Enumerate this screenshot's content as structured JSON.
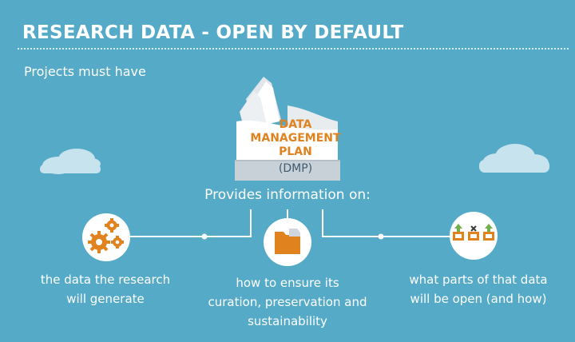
{
  "header": {
    "title": "RESEARCH DATA - OPEN BY DEFAULT",
    "subtitle": "Projects must have"
  },
  "document": {
    "title_lines": [
      "DATA",
      "MANAGEMENT",
      "PLAN"
    ],
    "abbreviation": "(DMP)"
  },
  "connector_label": "Provides information on:",
  "items": [
    {
      "icon": "gears-icon",
      "lines": [
        "the data the research",
        "will generate"
      ]
    },
    {
      "icon": "folder-icon",
      "lines": [
        "how to ensure its",
        "curation, preservation and",
        "sustainability"
      ]
    },
    {
      "icon": "open-boxes-icon",
      "lines": [
        "what parts of that data",
        "will be open (and how)"
      ]
    }
  ],
  "colors": {
    "background": "#55aac8",
    "accent": "#e0821e",
    "text": "#ffffff",
    "document_sub": "#3f5a70",
    "cloud": "#c7e3ee"
  }
}
